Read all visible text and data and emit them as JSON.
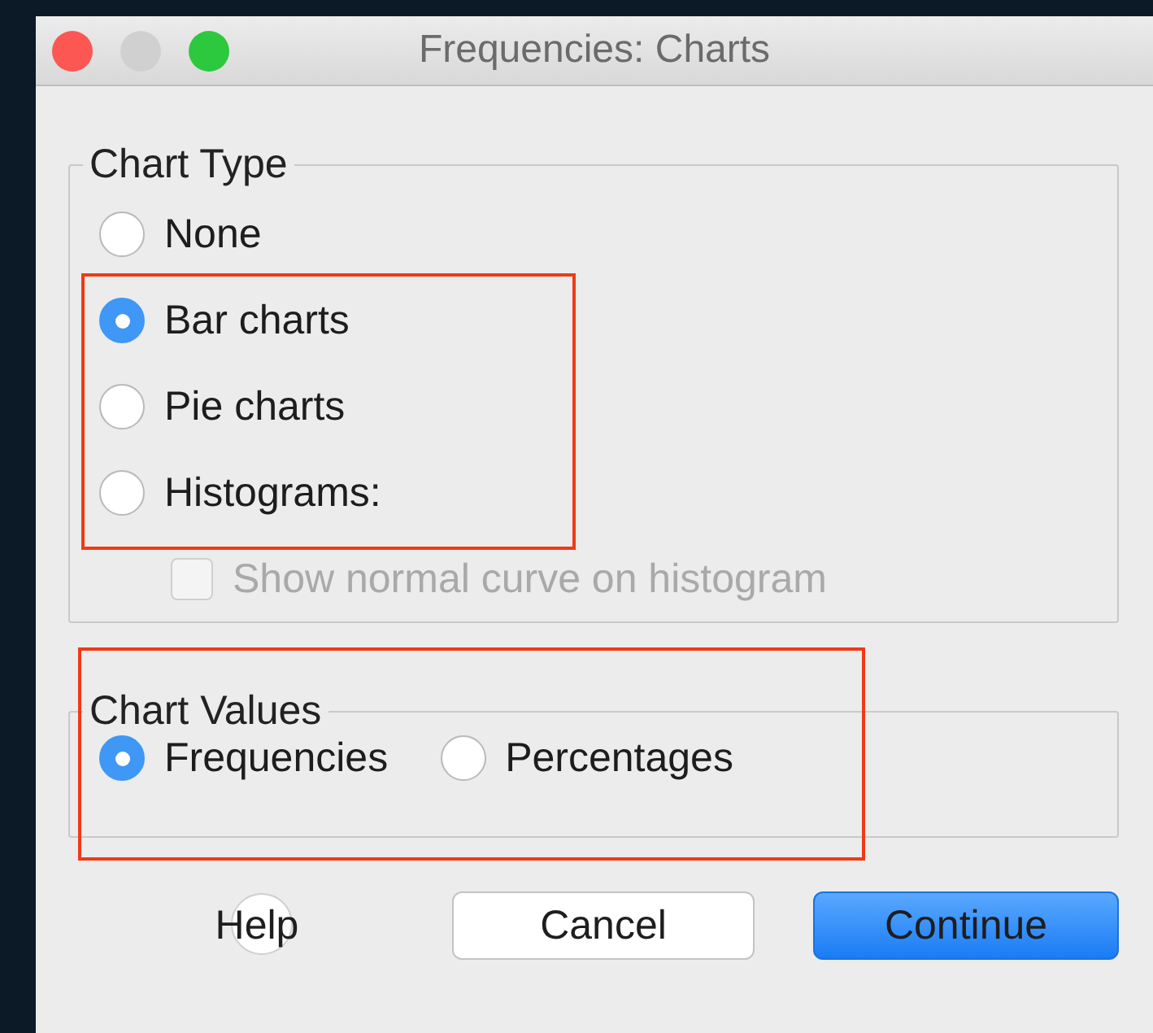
{
  "window": {
    "title": "Frequencies: Charts"
  },
  "chart_type": {
    "title": "Chart Type",
    "options": [
      {
        "label": "None",
        "selected": false
      },
      {
        "label": "Bar charts",
        "selected": true
      },
      {
        "label": "Pie charts",
        "selected": false
      },
      {
        "label": "Histograms:",
        "selected": false
      }
    ],
    "normal_curve": {
      "label": "Show normal curve on histogram",
      "checked": false,
      "disabled": true
    }
  },
  "chart_values": {
    "title": "Chart Values",
    "options": [
      {
        "label": "Frequencies",
        "selected": true
      },
      {
        "label": "Percentages",
        "selected": false
      }
    ]
  },
  "buttons": [
    {
      "label": "Help",
      "kind": "help"
    },
    {
      "label": "Cancel",
      "kind": "default"
    },
    {
      "label": "Continue",
      "kind": "primary"
    }
  ]
}
